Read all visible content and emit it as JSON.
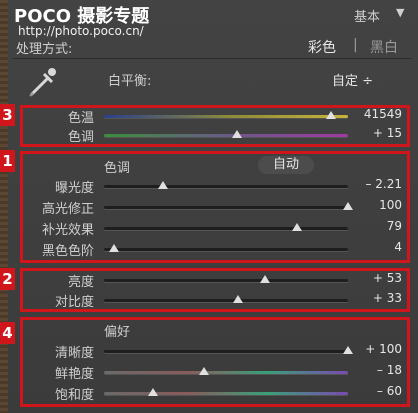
{
  "watermark": {
    "brand": "POCO 摄影专题",
    "url": "http://photo.poco.cn/"
  },
  "header": {
    "title": "基本",
    "arrow": "▼"
  },
  "treatment": {
    "label": "处理方式:",
    "color": "彩色",
    "separator": "|",
    "bw": "黑白"
  },
  "white_balance": {
    "label": "白平衡:",
    "value": "自定 ÷"
  },
  "temp_group": {
    "badge": "3",
    "rows": [
      {
        "label": "色温",
        "value": "41549",
        "level": 0.93
      },
      {
        "label": "色调",
        "value": "+ 15",
        "level": 0.545
      }
    ]
  },
  "tone_group": {
    "badge": "1",
    "title": "色调",
    "auto": "自动",
    "rows": [
      {
        "label": "曝光度",
        "value": "– 2.21",
        "level": 0.24
      },
      {
        "label": "高光修正",
        "value": "100",
        "level": 1.0
      },
      {
        "label": "补光效果",
        "value": "79",
        "level": 0.79
      },
      {
        "label": "黑色色阶",
        "value": "4",
        "level": 0.04
      }
    ]
  },
  "bc_group": {
    "badge": "2",
    "rows": [
      {
        "label": "亮度",
        "value": "+ 53",
        "level": 0.66
      },
      {
        "label": "对比度",
        "value": "+ 33",
        "level": 0.55
      }
    ]
  },
  "presence_group": {
    "badge": "4",
    "title": "偏好",
    "rows": [
      {
        "label": "清晰度",
        "value": "+ 100",
        "level": 1.0
      },
      {
        "label": "鲜艳度",
        "value": "– 18",
        "level": 0.41
      },
      {
        "label": "饱和度",
        "value": "– 60",
        "level": 0.2
      }
    ]
  },
  "colors": {
    "highlight_box": "#d0161b",
    "thumb": "#e0e0e0",
    "panel": "#3f3f3f"
  }
}
